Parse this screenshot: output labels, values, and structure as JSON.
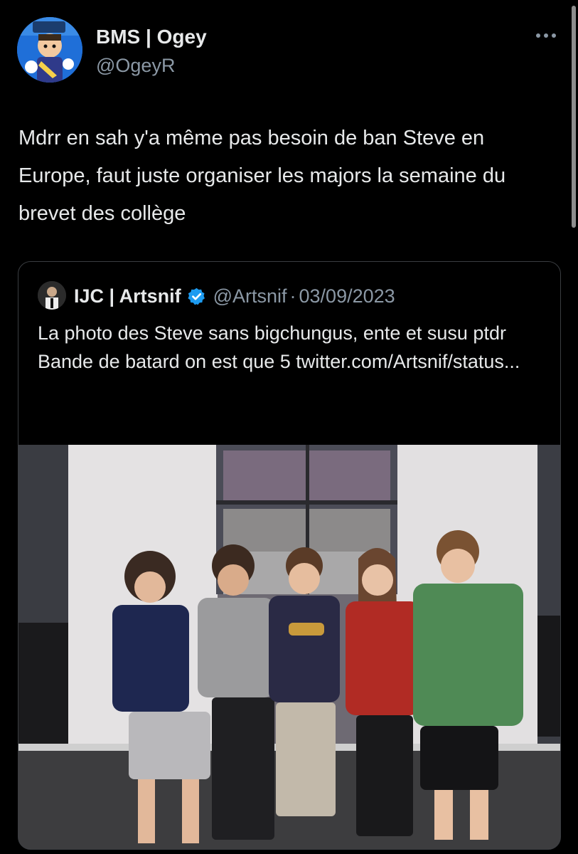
{
  "tweet": {
    "display_name": "BMS | Ogey",
    "handle": "@OgeyR",
    "text": "Mdrr en sah y'a même pas besoin de ban Steve en Europe, faut juste organiser les majors la semaine du brevet des collège",
    "more_icon": "more-horizontal-icon"
  },
  "quoted_tweet": {
    "display_name": "IJC | Artsnif",
    "verified_icon": "verified-badge-icon",
    "handle": "@Artsnif",
    "separator": "·",
    "date": "03/09/2023",
    "text_lines": [
      "La photo des Steve sans bigchungus, ente et susu ptdr",
      "Bande de batard on est que 5 twitter.com/Artsnif/status..."
    ]
  },
  "colors": {
    "background": "#000000",
    "text_primary": "#e7e9ea",
    "text_secondary": "#8b98a5",
    "verified_blue": "#1d9bf0",
    "border": "#3a3d41"
  }
}
